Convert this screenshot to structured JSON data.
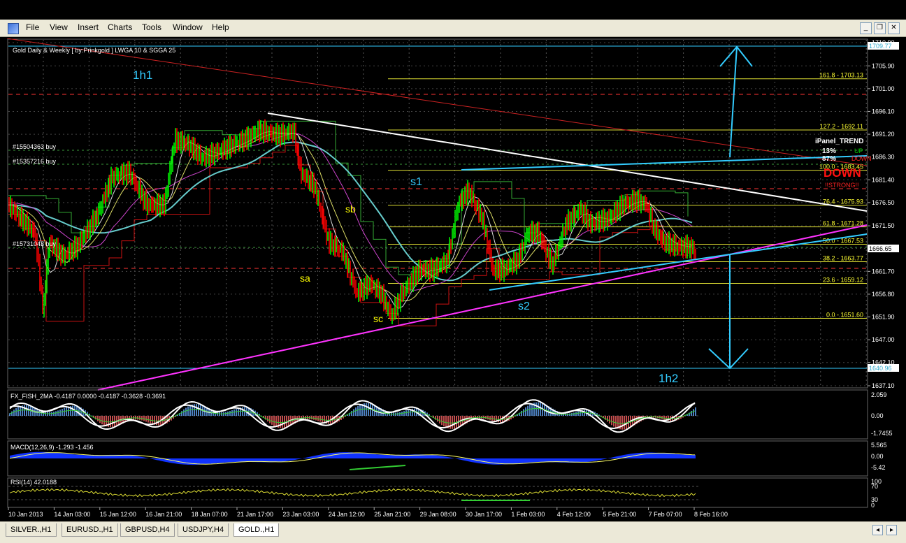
{
  "menu": [
    "File",
    "View",
    "Insert",
    "Charts",
    "Tools",
    "Window",
    "Help"
  ],
  "window_buttons": [
    "_",
    "❐",
    "✕"
  ],
  "chart": {
    "header": "Gold Daily & Weekly [ by:Prinkgold ]  LWGA 10  &  SGGA 25",
    "labels": {
      "h1": "1h1",
      "h2": "1h2",
      "s1": "s1",
      "s2": "s2",
      "sa": "sa",
      "sb": "sb",
      "sc": "sc"
    },
    "orders": [
      "#15504363 buy",
      "#15357216 buy",
      "#15731043 buy"
    ],
    "price_axis": [
      "1710.90",
      "1705.90",
      "1701.00",
      "1696.10",
      "1691.20",
      "1686.30",
      "1681.40",
      "1676.50",
      "1671.50",
      "1666.65",
      "1661.70",
      "1656.80",
      "1651.90",
      "1647.00",
      "1642.10",
      "1637.10"
    ],
    "current_price": "1666.65",
    "upper_level": "1709.77",
    "lower_level": "1640.96",
    "fibo": [
      "161.8 - 1703.13",
      "127.2 - 1692.11",
      "100.0 - 1683.45",
      "76.4 - 1675.93",
      "61.8 - 1671.28",
      "50.0 - 1667.53",
      "38.2 - 1663.77",
      "23.6 - 1659.12",
      "0.0 - 1651.60"
    ],
    "panel": {
      "title": "iPanel_TREND",
      "up_pct": "13%",
      "up": "UP",
      "down_pct": "87%",
      "down": "DOWN",
      "big": "DOWN",
      "strong": "!!STRONG!!"
    },
    "time_axis": [
      "10 Jan 2013",
      "14 Jan 03:00",
      "15 Jan 12:00",
      "16 Jan 21:00",
      "18 Jan 07:00",
      "21 Jan 17:00",
      "23 Jan 03:00",
      "24 Jan 12:00",
      "25 Jan 21:00",
      "29 Jan 08:00",
      "30 Jan 17:00",
      "1 Feb 03:00",
      "4 Feb 12:00",
      "5 Feb 21:00",
      "7 Feb 07:00",
      "8 Feb 16:00"
    ]
  },
  "fisher": {
    "label": "FX_FISH_2MA -0.4187 0.0000 -0.4187 -0.3628 -0.3691",
    "scale": [
      "2.059",
      "0.00",
      "-1.7455"
    ]
  },
  "macd": {
    "label": "MACD(12,26,9) -1.293 -1.456",
    "scale": [
      "5.565",
      "0.00",
      "-5.42"
    ]
  },
  "rsi": {
    "label": "RSI(14) 42.0188",
    "scale": [
      "100",
      "70",
      "30",
      "0"
    ]
  },
  "tabs": [
    "SILVER.,H1",
    "EURUSD.,H1",
    "GBPUSD,H4",
    "USDJPY,H4",
    "GOLD.,H1"
  ],
  "active_tab": "GOLD.,H1",
  "colors": {
    "price_up": "#00ff00",
    "price_down": "#ff0000",
    "fibo": "#ffff00",
    "cyan": "#33ccff",
    "magenta": "#ff33ff"
  }
}
